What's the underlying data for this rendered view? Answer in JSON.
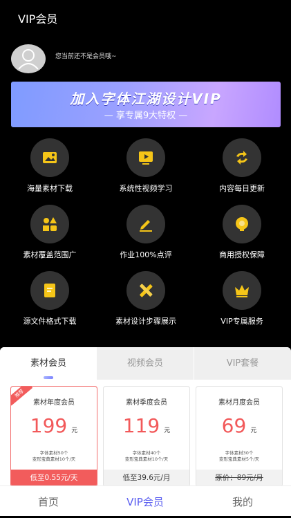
{
  "header": {
    "title": "VIP会员"
  },
  "user": {
    "status_text": "您当前还不是会员哦~"
  },
  "banner": {
    "title": "加入字体江湖设计VIP",
    "subtitle": "— 享专属9大特权 —"
  },
  "features": [
    {
      "label": "海量素材下载",
      "icon": "picture-icon"
    },
    {
      "label": "系统性视频学习",
      "icon": "video-icon"
    },
    {
      "label": "内容每日更新",
      "icon": "refresh-icon"
    },
    {
      "label": "素材覆盖范围广",
      "icon": "shapes-icon"
    },
    {
      "label": "作业100%点评",
      "icon": "edit-icon"
    },
    {
      "label": "商用授权保障",
      "icon": "shield-icon"
    },
    {
      "label": "源文件格式下载",
      "icon": "file-icon"
    },
    {
      "label": "素材设计步骤展示",
      "icon": "tools-icon"
    },
    {
      "label": "VIP专属服务",
      "icon": "crown-icon"
    }
  ],
  "tabs": [
    "素材会员",
    "视频会员",
    "VIP套餐"
  ],
  "plans": [
    {
      "badge": "推荐",
      "name": "素材年度会员",
      "price": "199",
      "unit": "元",
      "desc1": "字体素材50个",
      "desc2": "变形宝典素材10个/天",
      "footer": "低至0.55元/天"
    },
    {
      "name": "素材季度会员",
      "price": "119",
      "unit": "元",
      "desc1": "字体素材40个",
      "desc2": "变形宝典素材10个/天",
      "footer": "低至39.6元/月"
    },
    {
      "name": "素材月度会员",
      "price": "69",
      "unit": "元",
      "desc1": "字体素材30个",
      "desc2": "变形宝典素材5个/天",
      "footer": "原价：89元/月"
    }
  ],
  "nav": [
    "首页",
    "VIP会员",
    "我的"
  ],
  "colors": {
    "accent": "#5a5ef0",
    "price": "#f2595a",
    "icon_yellow": "#f5c518",
    "feature_bg": "#333333"
  }
}
